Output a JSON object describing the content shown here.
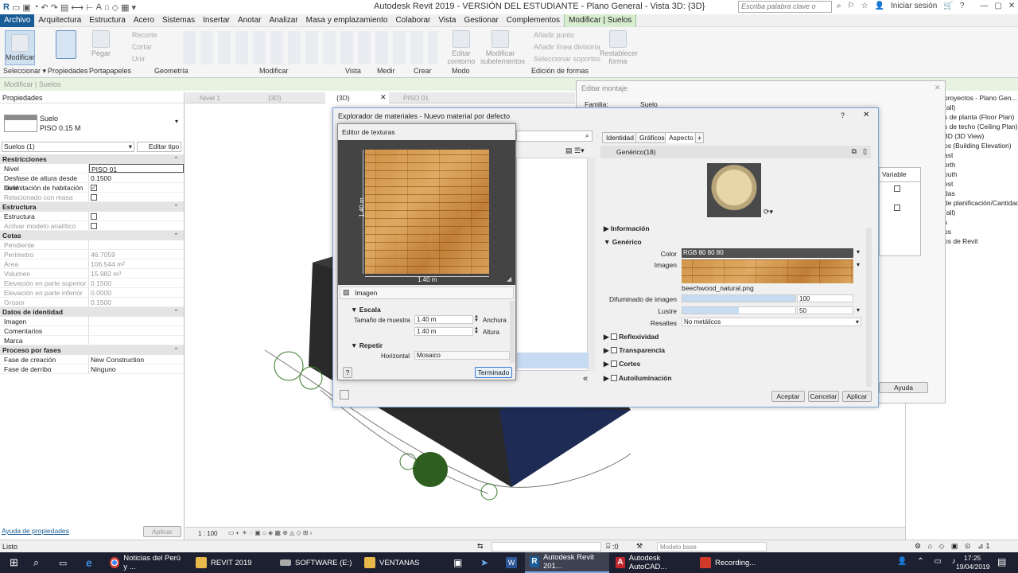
{
  "titlebar": {
    "title": "Autodesk Revit 2019 - VERSIÓN DEL ESTUDIANTE - Plano General - Vista 3D: {3D}",
    "search_placeholder": "Escriba palabra clave o frase",
    "signin": "Iniciar sesión"
  },
  "menubar": {
    "tabs": [
      "Archivo",
      "Arquitectura",
      "Estructura",
      "Acero",
      "Sistemas",
      "Insertar",
      "Anotar",
      "Analizar",
      "Masa y emplazamiento",
      "Colaborar",
      "Vista",
      "Gestionar",
      "Complementos",
      "Modificar | Suelos"
    ]
  },
  "ribbon": {
    "modify": "Modificar",
    "paste": "Pegar",
    "small": [
      "Recorte",
      "Cortar",
      "Unir"
    ],
    "edit_contour": "Editar contorno",
    "modify_subelements": "Modificar subelementos",
    "add_point": "Añadir punto",
    "add_division_line": "Añadir línea divisoria",
    "select_supports": "Seleccionar soportes",
    "reset_shape": "Restablecer forma",
    "groups": [
      "Seleccionar ▾",
      "Propiedades",
      "Portapapeles",
      "Geometría",
      "Modificar",
      "Vista",
      "Medir",
      "Crear",
      "Modo",
      "Edición de formas"
    ]
  },
  "context_bar": "Modificar | Suelos",
  "properties": {
    "header": "Propiedades",
    "family": "Suelo",
    "type": "PISO 0.15 M",
    "instance_filter": "Suelos (1)",
    "edit_type": "Editar tipo",
    "sections": [
      {
        "title": "Restricciones",
        "rows": [
          {
            "k": "Nivel",
            "v": "PISO 01"
          },
          {
            "k": "Desfase de altura desde nivel",
            "v": "0.1500"
          },
          {
            "k": "Delimitación de habitación",
            "v": "✓"
          },
          {
            "k": "Relacionado con masa",
            "v": ""
          }
        ]
      },
      {
        "title": "Estructura",
        "rows": [
          {
            "k": "Estructura",
            "v": ""
          },
          {
            "k": "Activar modelo analítico",
            "v": ""
          }
        ]
      },
      {
        "title": "Cotas",
        "rows": [
          {
            "k": "Pendiente",
            "v": ""
          },
          {
            "k": "Perímetro",
            "v": "46.7059"
          },
          {
            "k": "Área",
            "v": "106.544 m²"
          },
          {
            "k": "Volumen",
            "v": "15.982 m³"
          },
          {
            "k": "Elevación en parte superior",
            "v": "0.1500"
          },
          {
            "k": "Elevación en parte inferior",
            "v": "0.0000"
          },
          {
            "k": "Grosor",
            "v": "0.1500"
          }
        ]
      },
      {
        "title": "Datos de identidad",
        "rows": [
          {
            "k": "Imagen",
            "v": ""
          },
          {
            "k": "Comentarios",
            "v": ""
          },
          {
            "k": "Marca",
            "v": ""
          }
        ]
      },
      {
        "title": "Proceso por fases",
        "rows": [
          {
            "k": "Fase de creación",
            "v": "New Construction"
          },
          {
            "k": "Fase de derribo",
            "v": "Ninguno"
          }
        ]
      }
    ],
    "help_link": "Ayuda de propiedades",
    "apply": "Aplicar"
  },
  "view_tabs": [
    "Nivel 1",
    "{3D}",
    "{3D}",
    "PISO 01"
  ],
  "view_scale": "1 : 100",
  "browser": {
    "items": [
      "proyectos - Plano Gen...",
      "(all)",
      "s de planta (Floor Plan)",
      "s de techo (Ceiling Plan)",
      "3D (3D View)",
      "os (Building Elevation)",
      "ast",
      "orth",
      "outh",
      "est",
      "das",
      "de planificación/Cantidad",
      "(all)",
      "s",
      "os",
      "os de Revit"
    ]
  },
  "edit_assembly": {
    "title": "Editar montaje",
    "family_label": "Familia:",
    "family_value": "Suelo",
    "variable_col": "Variable",
    "help": "Ayuda"
  },
  "material_browser": {
    "title": "Explorador de materiales - Nuevo material por defecto",
    "tabs": [
      "Identidad",
      "Gráficos",
      "Aspecto",
      "+"
    ],
    "asset_name": "Genérico(18)",
    "sections": [
      "Información",
      "Genérico"
    ],
    "color_label": "Color",
    "color_value": "RGB 80 80 80",
    "image_label": "Imagen",
    "image_file": "beechwood_natural.png",
    "fade_label": "Difuminado de imagen",
    "fade_value": "100",
    "fade_fraction": 1.0,
    "gloss_label": "Lustre",
    "gloss_value": "50",
    "gloss_fraction": 0.5,
    "highlights_label": "Resaltes",
    "highlights_value": "No metálicos",
    "extra_sections": [
      "Reflexividad",
      "Transparencia",
      "Cortes",
      "Autoiluminación"
    ],
    "accept": "Aceptar",
    "cancel": "Cancelar",
    "apply": "Aplicar"
  },
  "texture_editor": {
    "title": "Editor de texturas",
    "dim_vertical": "1.40 m",
    "dim_horizontal": "1.40 m",
    "image_section": "Imagen",
    "scale_section": "Escala",
    "sample_size_label": "Tamaño de muestra",
    "width_value": "1.40 m",
    "width_label": "Anchura",
    "height_value": "1.40 m",
    "height_label": "Altura",
    "repeat_section": "Repetir",
    "horizontal_label": "Horizontal",
    "horizontal_value": "Mosaico",
    "help": "?",
    "done": "Terminado"
  },
  "statusbar": {
    "left": "Listo",
    "zero": ":0",
    "model": "Modelo base"
  },
  "taskbar": {
    "items": [
      "Noticias del Perú y ...",
      "REVIT 2019",
      "SOFTWARE (E:)",
      "VENTANAS",
      "Autodesk Revit 201...",
      "Autodesk AutoCAD...",
      "Recording..."
    ],
    "time": "17:25",
    "date": "19/04/2019"
  },
  "colors": {
    "archivo": "#1a5c95",
    "context_tab": "#d8ecd0",
    "taskbar": "#1d2030"
  }
}
